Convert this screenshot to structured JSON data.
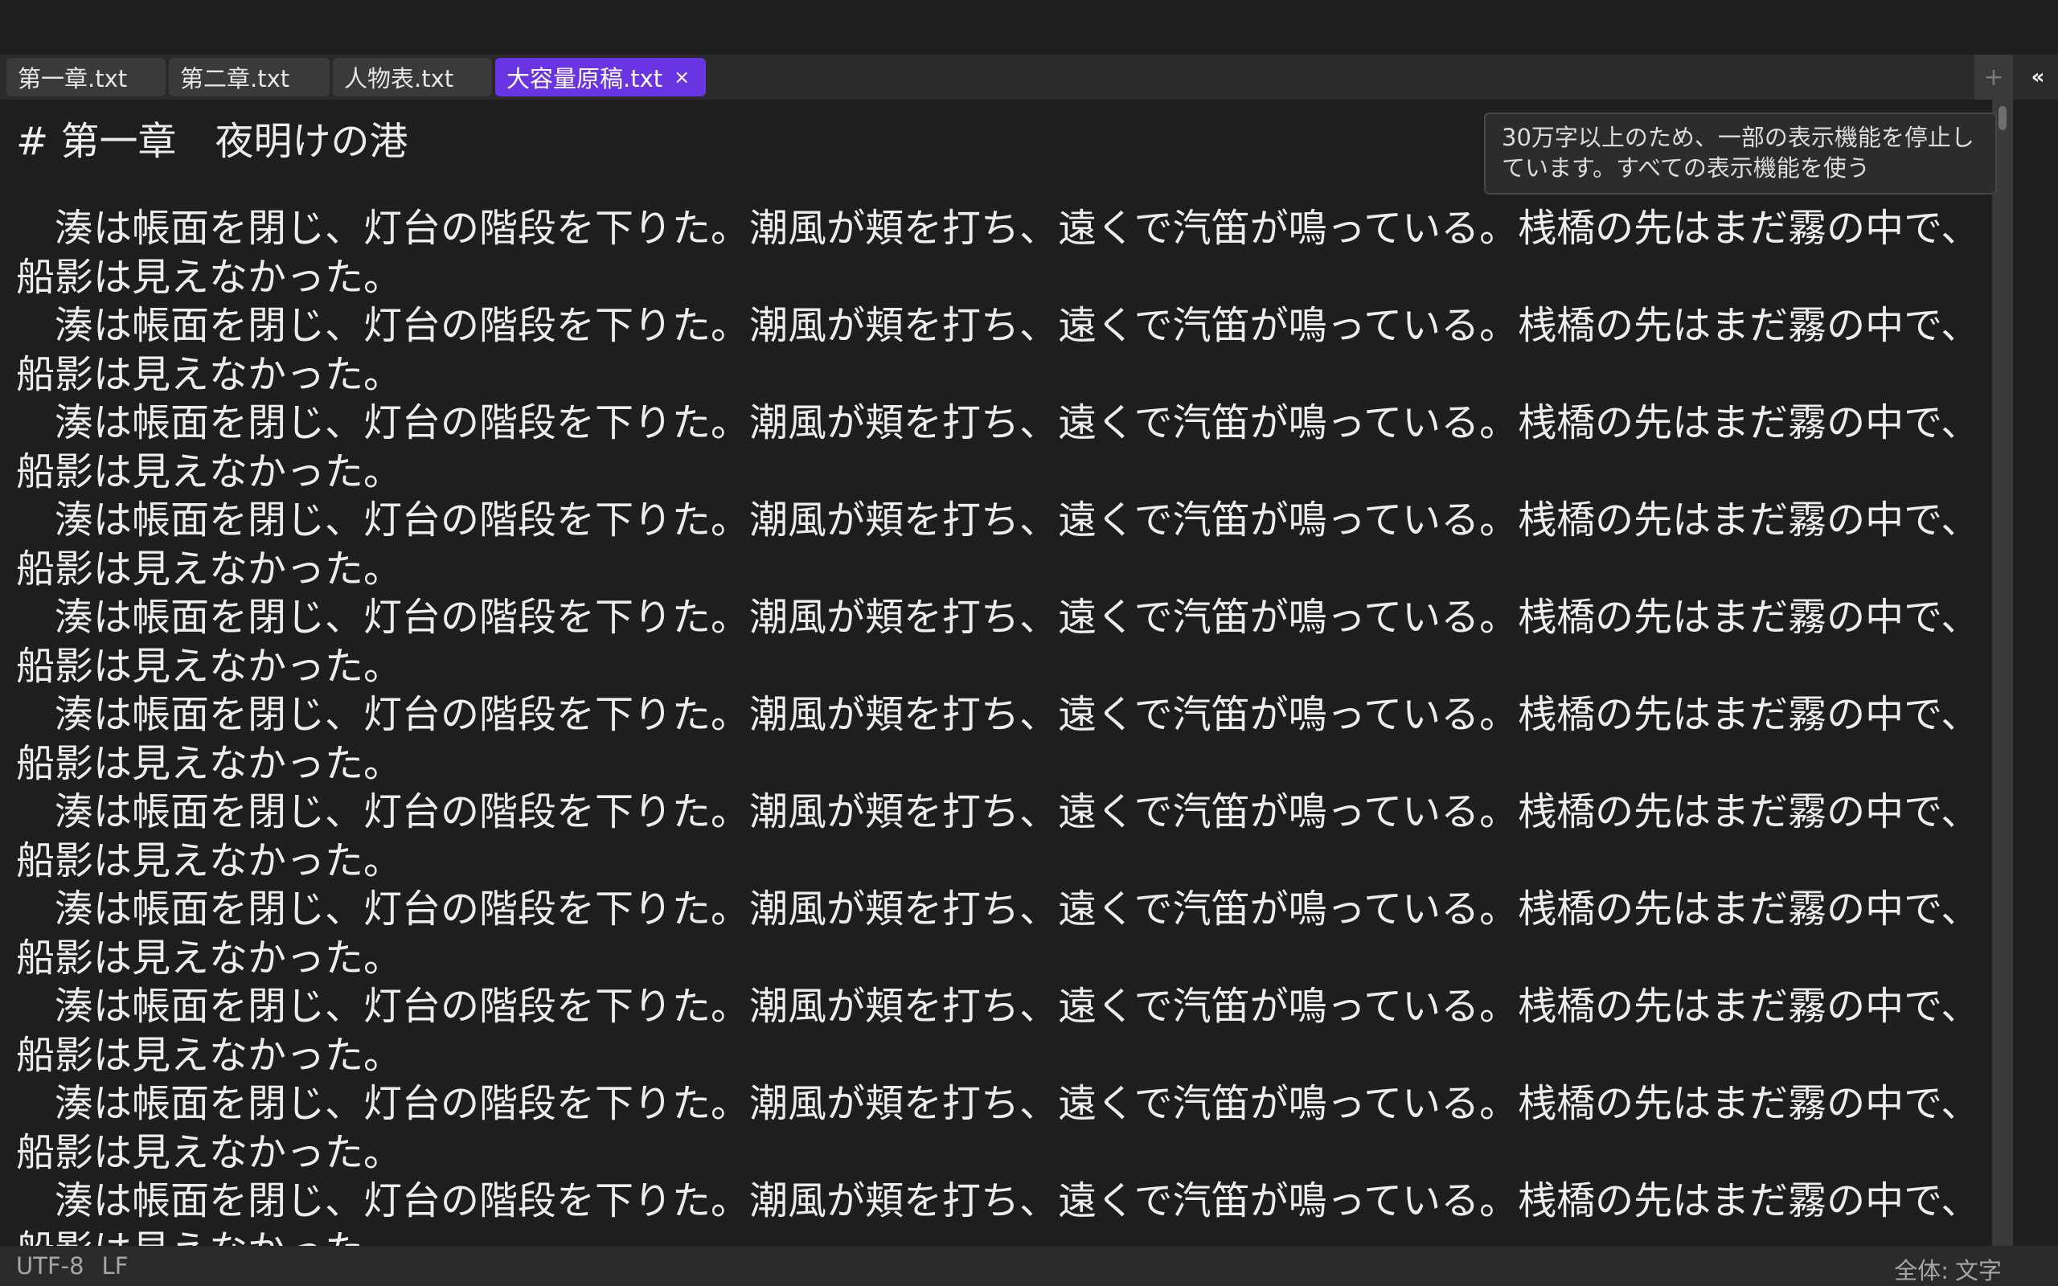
{
  "tabs": [
    {
      "label": "第一章.txt",
      "active": false
    },
    {
      "label": "第二章.txt",
      "active": false
    },
    {
      "label": "人物表.txt",
      "active": false
    },
    {
      "label": "大容量原稿.txt",
      "active": true
    }
  ],
  "tab_close_glyph": "×",
  "new_tab_glyph": "+",
  "collapse_glyph": "«",
  "accent_color": "#6a34e2",
  "editor": {
    "heading": "# 第一章　夜明けの港",
    "paragraph": "湊は帳面を閉じ、灯台の階段を下りた。潮風が頬を打ち、遠くで汽笛が鳴っている。桟橋の先はまだ霧の中で、船影は見えなかった。",
    "paragraphs": [
      "湊は帳面を閉じ、灯台の階段を下りた。潮風が頬を打ち、遠くで汽笛が鳴っている。桟橋の先はまだ霧の中で、船影は見えなかった。",
      "湊は帳面を閉じ、灯台の階段を下りた。潮風が頬を打ち、遠くで汽笛が鳴っている。桟橋の先はまだ霧の中で、船影は見えなかった。",
      "湊は帳面を閉じ、灯台の階段を下りた。潮風が頬を打ち、遠くで汽笛が鳴っている。桟橋の先はまだ霧の中で、船影は見えなかった。",
      "湊は帳面を閉じ、灯台の階段を下りた。潮風が頬を打ち、遠くで汽笛が鳴っている。桟橋の先はまだ霧の中で、船影は見えなかった。",
      "湊は帳面を閉じ、灯台の階段を下りた。潮風が頬を打ち、遠くで汽笛が鳴っている。桟橋の先はまだ霧の中で、船影は見えなかった。",
      "湊は帳面を閉じ、灯台の階段を下りた。潮風が頬を打ち、遠くで汽笛が鳴っている。桟橋の先はまだ霧の中で、船影は見えなかった。",
      "湊は帳面を閉じ、灯台の階段を下りた。潮風が頬を打ち、遠くで汽笛が鳴っている。桟橋の先はまだ霧の中で、船影は見えなかった。",
      "湊は帳面を閉じ、灯台の階段を下りた。潮風が頬を打ち、遠くで汽笛が鳴っている。桟橋の先はまだ霧の中で、船影は見えなかった。",
      "湊は帳面を閉じ、灯台の階段を下りた。潮風が頬を打ち、遠くで汽笛が鳴っている。桟橋の先はまだ霧の中で、船影は見えなかった。",
      "湊は帳面を閉じ、灯台の階段を下りた。潮風が頬を打ち、遠くで汽笛が鳴っている。桟橋の先はまだ霧の中で、船影は見えなかった。",
      "湊は帳面を閉じ、灯台の階段を下りた。潮風が頬を打ち、遠くで汽笛が鳴っている。桟橋の先はまだ霧の中で、船影は見えなかった。"
    ]
  },
  "tooltip": {
    "text": "30万字以上のため、一部の表示機能を停止しています。すべての表示機能を使う"
  },
  "status": {
    "encoding": "UTF-8",
    "line_ending": "LF",
    "scope_label": "全体:",
    "count_label": "文字"
  }
}
